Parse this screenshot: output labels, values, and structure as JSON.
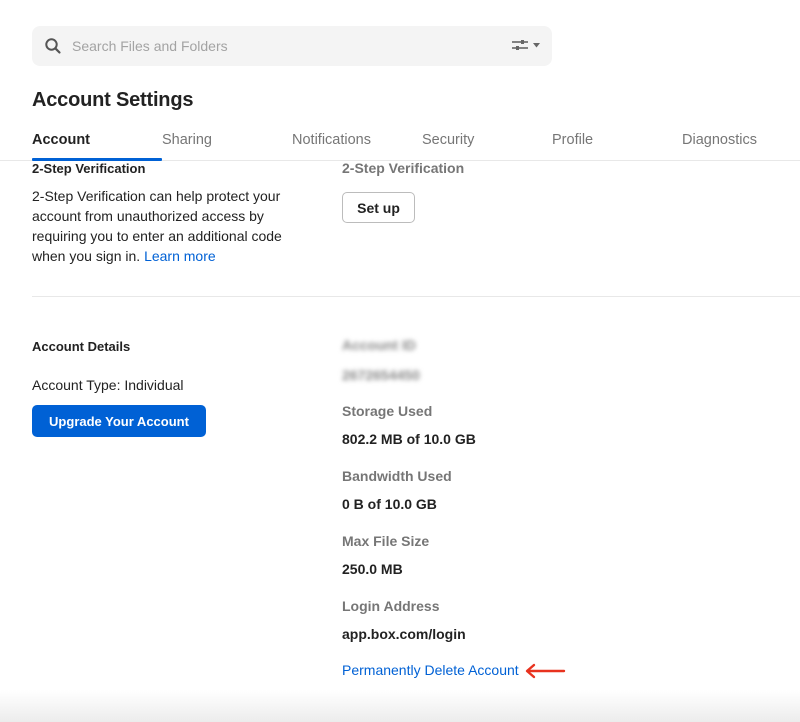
{
  "search": {
    "placeholder": "Search Files and Folders",
    "value": "",
    "icon": "search-icon",
    "filter_icon": "sliders-icon"
  },
  "header": {
    "title": "Account Settings"
  },
  "tabs": [
    {
      "label": "Account",
      "active": true
    },
    {
      "label": "Sharing",
      "active": false
    },
    {
      "label": "Notifications",
      "active": false
    },
    {
      "label": "Security",
      "active": false
    },
    {
      "label": "Profile",
      "active": false
    },
    {
      "label": "Diagnostics",
      "active": false
    }
  ],
  "two_step": {
    "section_title": "2-Step Verification",
    "description": "2-Step Verification can help protect your account from unauthorized access by requiring you to enter an additional code when you sign in.",
    "learn_more": "Learn more",
    "field_label": "2-Step Verification",
    "setup_button": "Set up"
  },
  "account_details": {
    "section_title": "Account Details",
    "account_type": "Account Type: Individual",
    "upgrade_button": "Upgrade Your Account",
    "account_id_label": "Account ID",
    "account_id_value": "2672654450",
    "fields": [
      {
        "label": "Storage Used",
        "value": "802.2 MB of 10.0 GB"
      },
      {
        "label": "Bandwidth Used",
        "value": "0 B of 10.0 GB"
      },
      {
        "label": "Max File Size",
        "value": "250.0 MB"
      },
      {
        "label": "Login Address",
        "value": "app.box.com/login"
      }
    ],
    "delete_link": "Permanently Delete Account"
  },
  "colors": {
    "accent": "#0061d5",
    "annotation_arrow": "#e8321e",
    "muted_text": "#767676"
  }
}
